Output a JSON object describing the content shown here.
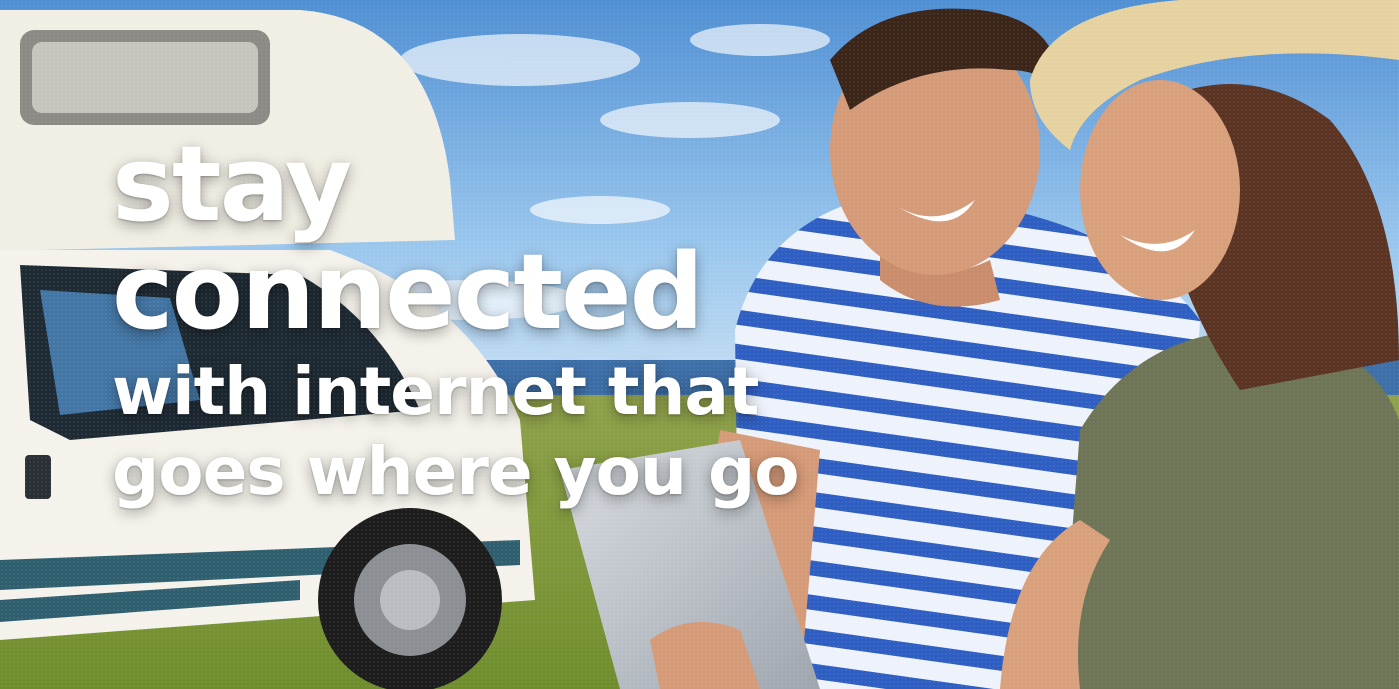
{
  "banner": {
    "headline": {
      "line1": "stay",
      "line2": "connected",
      "line3": "with internet that",
      "line4": "goes where you go"
    }
  },
  "colors": {
    "sky": "#7fb5e6",
    "grass": "#8aa04a",
    "rv_body": "#f1efe4",
    "rv_trim": "#2f5f6f",
    "shirt_stripe": "#2f5ec2",
    "tank_top": "#6e7456",
    "hat_straw": "#e6d2a0",
    "text": "#ffffff"
  },
  "icons": {
    "rv": "motorhome-illustration",
    "man": "man-illustration",
    "woman": "woman-illustration",
    "tablet": "tablet-illustration"
  }
}
